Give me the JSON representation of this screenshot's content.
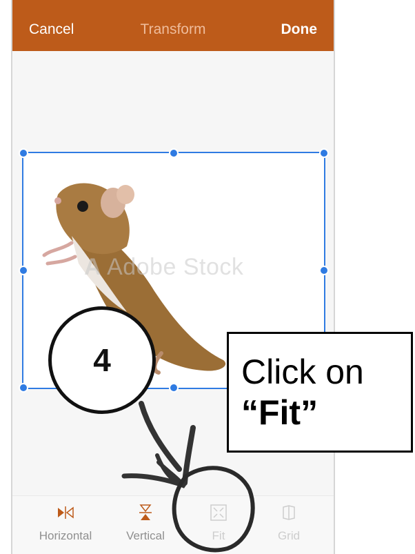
{
  "header": {
    "cancel_label": "Cancel",
    "title": "Transform",
    "done_label": "Done"
  },
  "image": {
    "watermark": "Adobe Stock",
    "watermark_logo": "A",
    "subject": "mouse"
  },
  "toolbar": {
    "items": [
      {
        "label": "Horizontal",
        "icon": "flip-horizontal-icon",
        "enabled": true
      },
      {
        "label": "Vertical",
        "icon": "flip-vertical-icon",
        "enabled": true
      },
      {
        "label": "Fit",
        "icon": "fit-icon",
        "enabled": false
      },
      {
        "label": "Grid",
        "icon": "grid-icon",
        "enabled": false
      }
    ]
  },
  "annotation": {
    "step_number": "4",
    "instruction_line1": "Click on",
    "instruction_line2": "“Fit”"
  },
  "colors": {
    "header_bg": "#bd5b1a",
    "selection": "#2f7be2",
    "active_icon": "#bd5b1a"
  }
}
